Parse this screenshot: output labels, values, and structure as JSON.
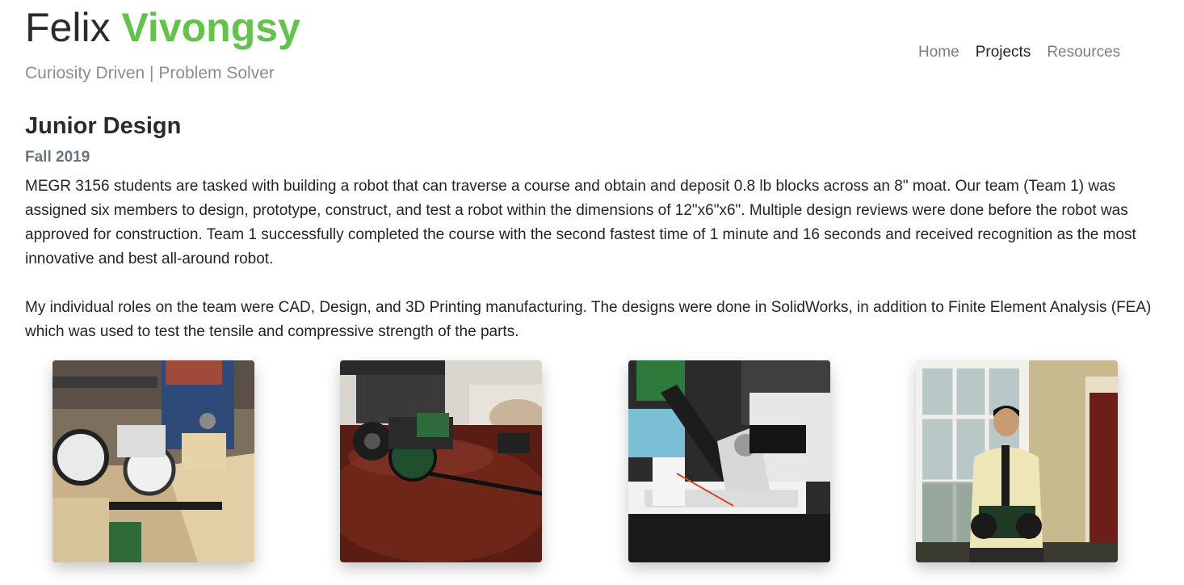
{
  "header": {
    "first_name": "Felix",
    "last_name": "Vivongsy",
    "tagline": "Curiosity Driven | Problem Solver"
  },
  "nav": {
    "items": [
      {
        "label": "Home",
        "active": false
      },
      {
        "label": "Projects",
        "active": true
      },
      {
        "label": "Resources",
        "active": false
      }
    ]
  },
  "project": {
    "title": "Junior Design",
    "term": "Fall 2019",
    "paragraph1": "MEGR 3156 students are tasked with building a robot that can traverse a course and obtain and deposit 0.8 lb blocks across an 8\" moat. Our team (Team 1) was assigned six members to design, prototype, construct, and test a robot within the dimensions of 12\"x6\"x6\". Multiple design reviews were done before the robot was approved for construction. Team 1 successfully completed the course with the second fastest time of 1 minute and 16 seconds and received recognition as the most innovative and best all-around robot.",
    "paragraph2": "My individual roles on the team were CAD, Design, and 3D Printing manufacturing. The designs were done in SolidWorks, in addition to Finite Element Analysis (FEA) which was used to test the tensile and compressive strength of the parts."
  },
  "colors": {
    "accent_green": "#63c14c",
    "muted_gray": "#868e96"
  }
}
